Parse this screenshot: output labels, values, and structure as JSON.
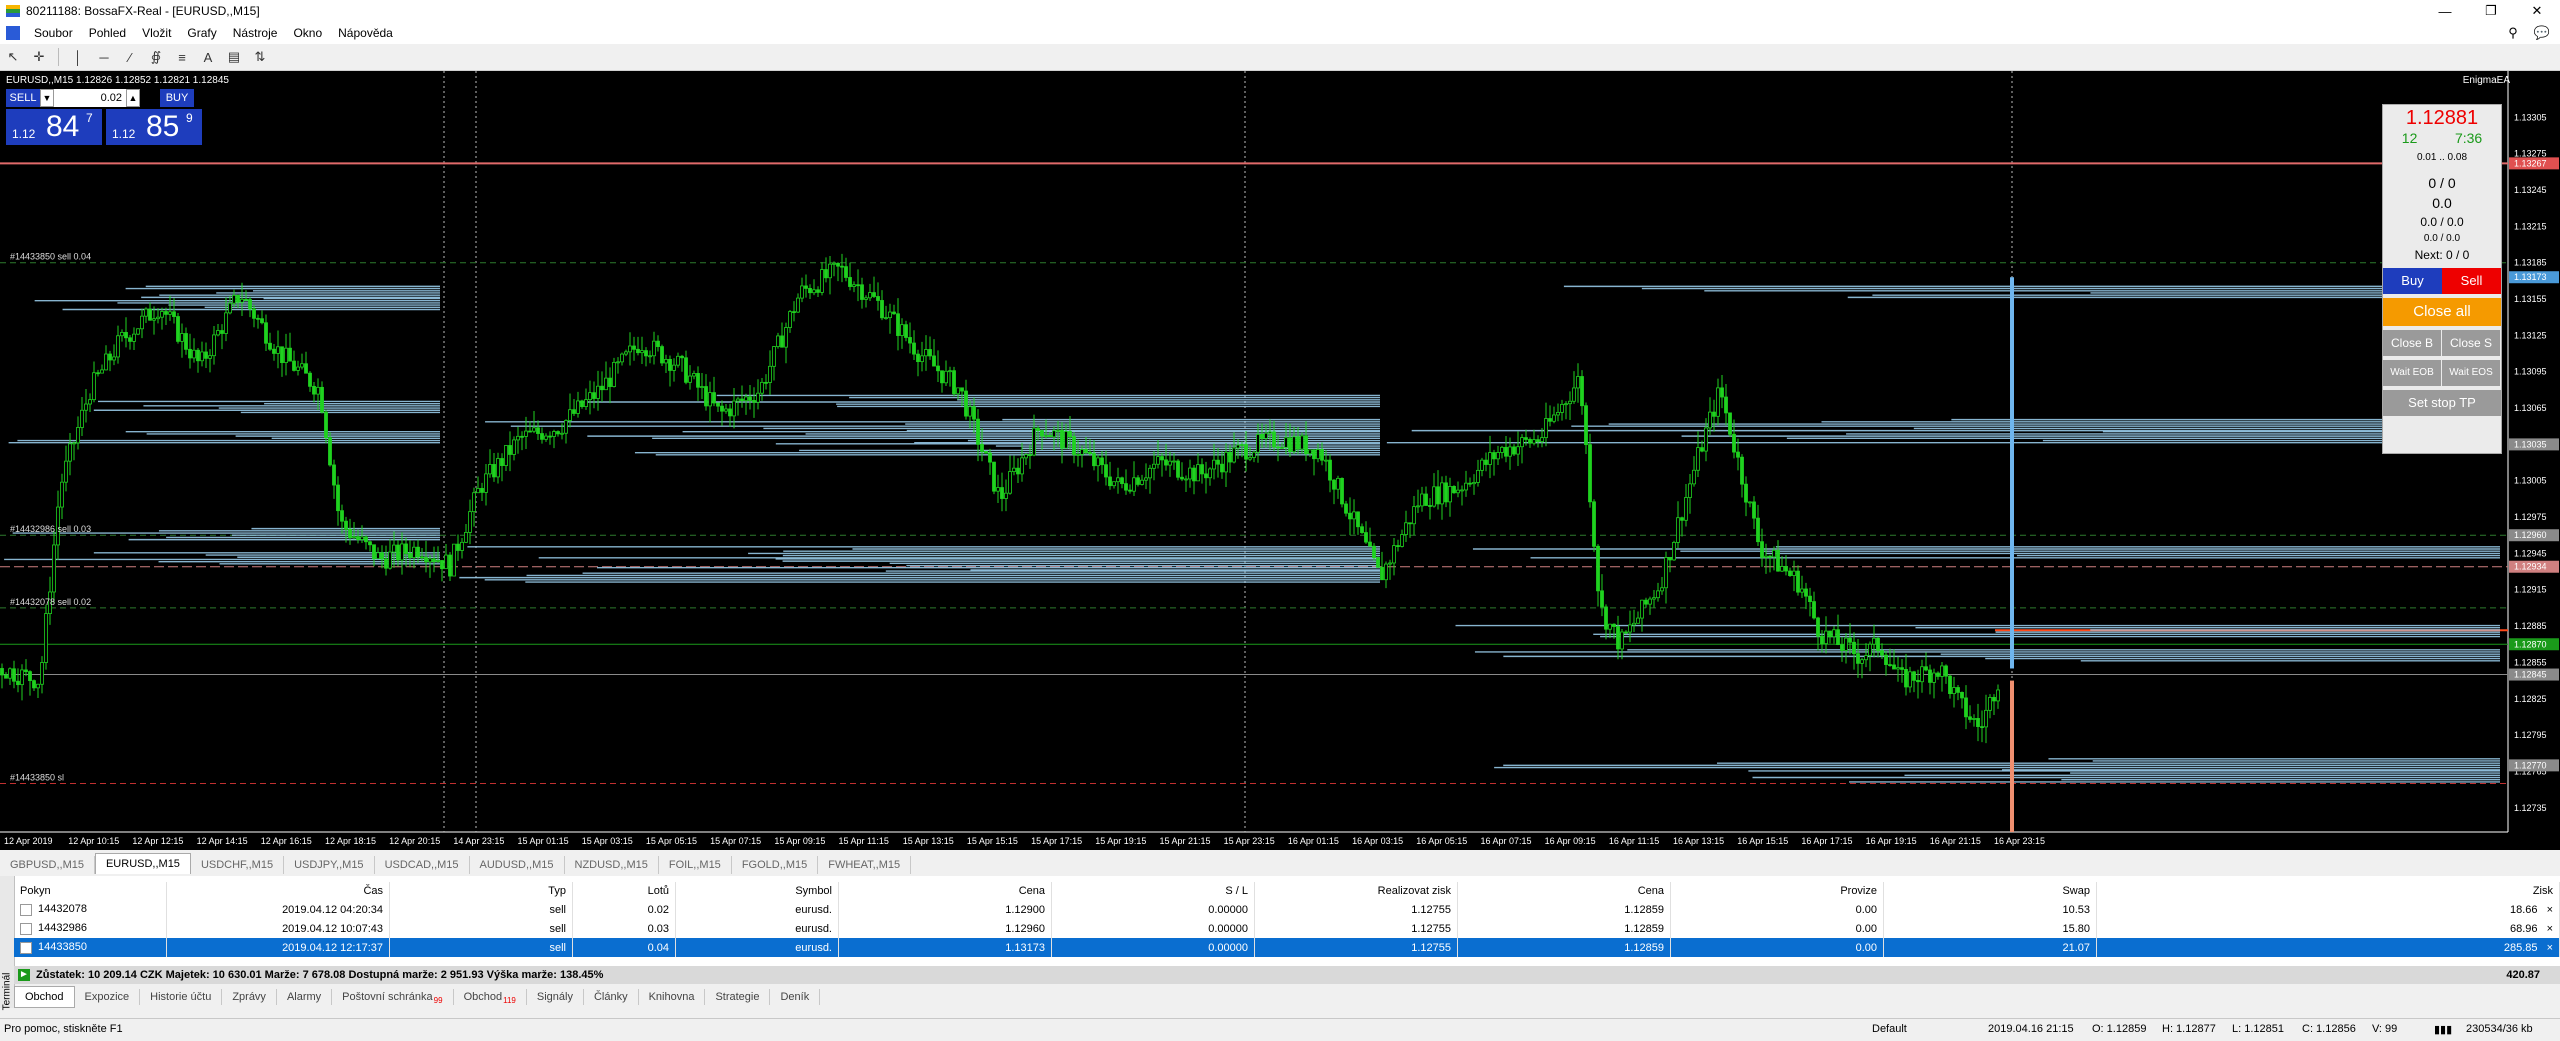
{
  "window": {
    "title": "80211188: BossaFX-Real - [EURUSD,,M15]"
  },
  "menu": [
    "Soubor",
    "Pohled",
    "Vložit",
    "Grafy",
    "Nástroje",
    "Okno",
    "Nápověda"
  ],
  "chart": {
    "header": "EURUSD,,M15  1.12826 1.12852 1.12821 1.12845",
    "indicator_name": "EnigmaEA",
    "trade_panel": {
      "sell": "SELL",
      "buy": "BUY",
      "lot": "0.02",
      "bid_prefix": "1.12",
      "bid_big": "84",
      "bid_sup": "7",
      "ask_prefix": "1.12",
      "ask_big": "85",
      "ask_sup": "9"
    },
    "order_labels": [
      "#14433850 sell 0.04",
      "#14432986 sell 0.03",
      "#14432078 sell 0.02",
      "#14433850 sl"
    ],
    "price_axis": [
      "1.13305",
      "1.13275",
      "1.13245",
      "1.13215",
      "1.13185",
      "1.13155",
      "1.13125",
      "1.13095",
      "1.13065",
      "1.13035",
      "1.13005",
      "1.12975",
      "1.12945",
      "1.12915",
      "1.12885",
      "1.12855",
      "1.12825",
      "1.12795",
      "1.12765",
      "1.12735"
    ],
    "price_tags": [
      {
        "text": "1.13267",
        "color": "#e05050"
      },
      {
        "text": "1.13173",
        "color": "#4a9ad9"
      },
      {
        "text": "1.13035",
        "color": "#8a8a8a"
      },
      {
        "text": "1.12960",
        "color": "#8a8a8a"
      },
      {
        "text": "1.12934",
        "color": "#d08080"
      },
      {
        "text": "1.12870",
        "color": "#1a9a1a"
      },
      {
        "text": "1.12845",
        "color": "#8a8a8a"
      },
      {
        "text": "1.12770",
        "color": "#8a8a8a"
      }
    ],
    "time_axis": [
      "12 Apr 2019",
      "12 Apr 10:15",
      "12 Apr 12:15",
      "12 Apr 14:15",
      "12 Apr 16:15",
      "12 Apr 18:15",
      "12 Apr 20:15",
      "14 Apr 23:15",
      "15 Apr 01:15",
      "15 Apr 03:15",
      "15 Apr 05:15",
      "15 Apr 07:15",
      "15 Apr 09:15",
      "15 Apr 11:15",
      "15 Apr 13:15",
      "15 Apr 15:15",
      "15 Apr 17:15",
      "15 Apr 19:15",
      "15 Apr 21:15",
      "15 Apr 23:15",
      "16 Apr 01:15",
      "16 Apr 03:15",
      "16 Apr 05:15",
      "16 Apr 07:15",
      "16 Apr 09:15",
      "16 Apr 11:15",
      "16 Apr 13:15",
      "16 Apr 15:15",
      "16 Apr 17:15",
      "16 Apr 19:15",
      "16 Apr 21:15",
      "16 Apr 23:15"
    ]
  },
  "ea_panel": {
    "price": "1.12881",
    "spread": "12",
    "timer": "7:36",
    "lot_range": "0.01 .. 0.08",
    "l1": "0 / 0",
    "l2": "0.0",
    "l3": "0.0 / 0.0",
    "l4": "0.0 / 0.0",
    "next": "Next: 0 / 0",
    "buy": "Buy",
    "sell": "Sell",
    "close_all": "Close all",
    "close_b": "Close B",
    "close_s": "Close S",
    "wait_eob": "Wait EOB",
    "wait_eos": "Wait EOS",
    "set_stop": "Set stop TP",
    "colors": {
      "buy": "#1e3dbd",
      "sell": "#e00000",
      "close_all": "#f59a00"
    }
  },
  "symbol_tabs": [
    "GBPUSD,,M15",
    "EURUSD,,M15",
    "USDCHF,,M15",
    "USDJPY,,M15",
    "USDCAD,,M15",
    "AUDUSD,,M15",
    "NZDUSD,,M15",
    "FOIL,,M15",
    "FGOLD,,M15",
    "FWHEAT,,M15"
  ],
  "terminal": {
    "label": "Terminál",
    "columns": [
      "Pokyn",
      "Čas",
      "Typ",
      "Lotů",
      "Symbol",
      "Cena",
      "S / L",
      "Realizovat zisk",
      "Cena",
      "Provize",
      "Swap",
      "Zisk"
    ],
    "rows": [
      [
        "14432078",
        "2019.04.12 04:20:34",
        "sell",
        "0.02",
        "eurusd.",
        "1.12900",
        "0.00000",
        "1.12755",
        "1.12859",
        "0.00",
        "10.53",
        "18.66"
      ],
      [
        "14432986",
        "2019.04.12 10:07:43",
        "sell",
        "0.03",
        "eurusd.",
        "1.12960",
        "0.00000",
        "1.12755",
        "1.12859",
        "0.00",
        "15.80",
        "68.96"
      ],
      [
        "14433850",
        "2019.04.12 12:17:37",
        "sell",
        "0.04",
        "eurusd.",
        "1.13173",
        "0.00000",
        "1.12755",
        "1.12859",
        "0.00",
        "21.07",
        "285.85"
      ]
    ],
    "balance": "Zůstatek: 10 209.14 CZK  Majetek: 10 630.01  Marže: 7 678.08  Dostupná marže: 2 951.93  Výška marže: 138.45%",
    "total": "420.87",
    "tabs": [
      {
        "label": "Obchod",
        "badge": ""
      },
      {
        "label": "Expozice",
        "badge": ""
      },
      {
        "label": "Historie účtu",
        "badge": ""
      },
      {
        "label": "Zprávy",
        "badge": ""
      },
      {
        "label": "Alarmy",
        "badge": ""
      },
      {
        "label": "Poštovní schránka",
        "badge": "99"
      },
      {
        "label": "Obchod",
        "badge": "119"
      },
      {
        "label": "Signály",
        "badge": ""
      },
      {
        "label": "Články",
        "badge": ""
      },
      {
        "label": "Knihovna",
        "badge": ""
      },
      {
        "label": "Strategie",
        "badge": ""
      },
      {
        "label": "Deník",
        "badge": ""
      }
    ]
  },
  "statusbar": {
    "help": "Pro pomoc, stiskněte F1",
    "profile": "Default",
    "datetime": "2019.04.16 21:15",
    "open": "O: 1.12859",
    "high": "H: 1.12877",
    "low": "L: 1.12851",
    "close": "C: 1.12856",
    "volume": "V: 99",
    "traffic": "230534/36 kb"
  }
}
